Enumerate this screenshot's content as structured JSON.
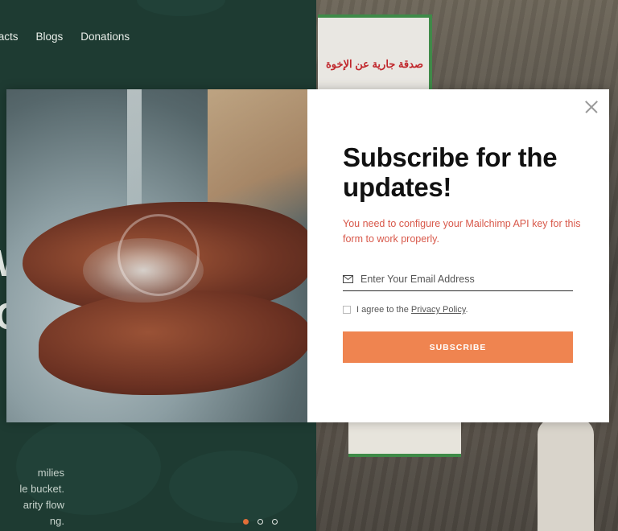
{
  "nav": {
    "items": [
      {
        "label": "tacts"
      },
      {
        "label": "Blogs"
      },
      {
        "label": "Donations"
      }
    ]
  },
  "hero": {
    "lines": [
      "milies",
      "le bucket.",
      "arity flow",
      "ng."
    ]
  },
  "background": {
    "banner_text": "صدقة جارية عن الإخوة"
  },
  "modal": {
    "title": "Subscribe for the updates!",
    "warning": "You need to configure your Mailchimp API key for this form to work properly.",
    "email_placeholder": "Enter Your Email Address",
    "agree_prefix": "I agree to the ",
    "agree_link": "Privacy Policy",
    "agree_suffix": ".",
    "button_label": "SUBSCRIBE"
  },
  "slider": {
    "total": 3,
    "active": 1
  },
  "colors": {
    "accent": "#ef8450",
    "dark_green": "#1e3b32",
    "warning": "#d8584a"
  }
}
